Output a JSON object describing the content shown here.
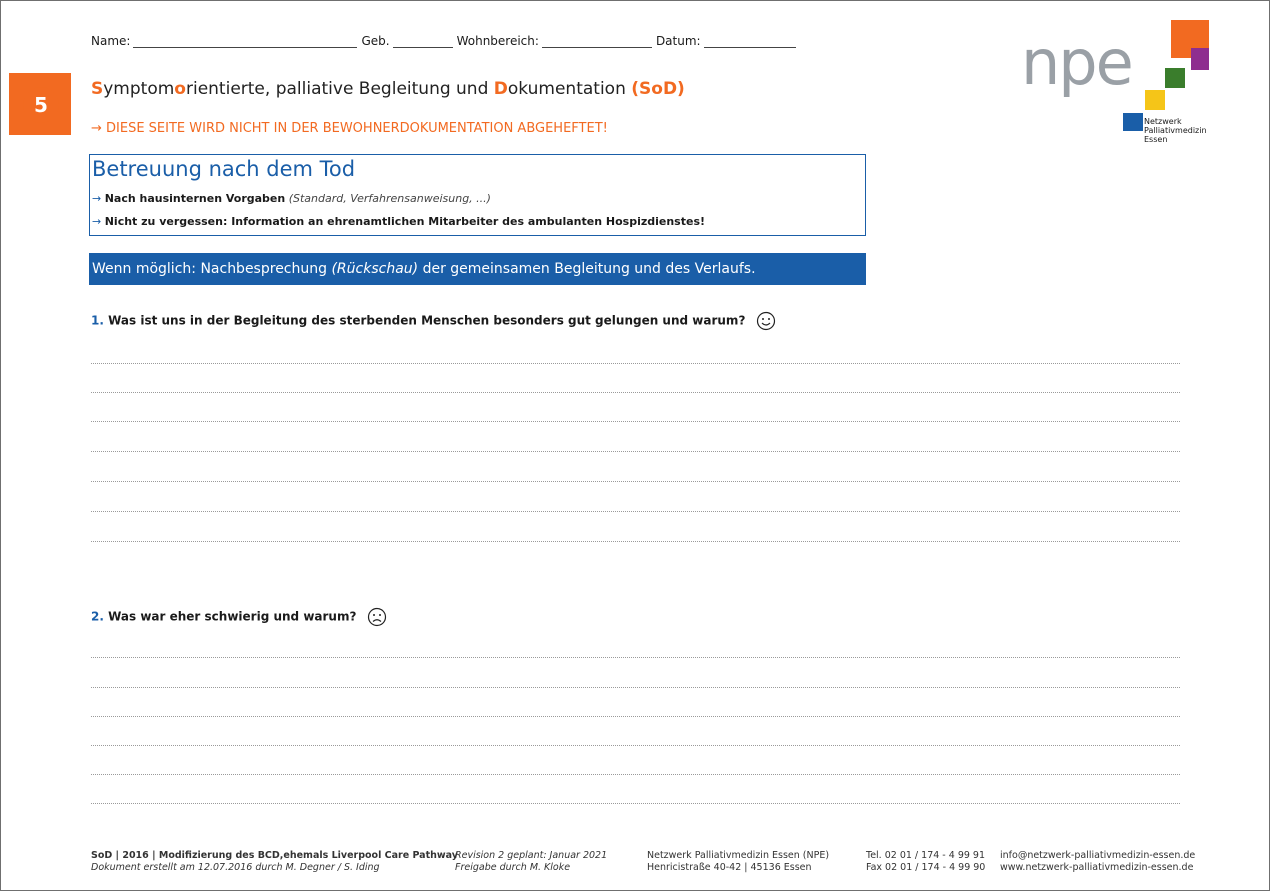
{
  "fields": {
    "name_label": "Name:",
    "geb_label": "Geb.",
    "wohnbereich_label": "Wohnbereich:",
    "datum_label": "Datum:"
  },
  "page_number": "5",
  "title": {
    "s": "S",
    "part1": "ymptom",
    "o": "o",
    "part2": "rientierte, palliative Begleitung und ",
    "d": "D",
    "part3": "okumentation ",
    "abbr": "(SoD)"
  },
  "notice": "→ DIESE SEITE WIRD NICHT IN DER BEWOHNERDOKUMENTATION ABGEHEFTET!",
  "logo": {
    "text": "npe",
    "line1": "Netzwerk",
    "line2": "Palliativmedizin",
    "line3": "Essen",
    "colors": [
      "#f26a21",
      "#8e2e8f",
      "#3a7d2c",
      "#f5c518",
      "#1a5ea8"
    ]
  },
  "box": {
    "title": "Betreuung nach dem Tod",
    "arrow": "→",
    "item1_bold": "Nach hausinternen Vorgaben",
    "item1_italic": "(Standard, Verfahrensanweisung, ...)",
    "item2_bold": "Nicht zu vergessen: Information an ehrenamtlichen Mitarbeiter des ambulanten Hospizdienstes!"
  },
  "bar": {
    "part1": "Wenn möglich: Nachbesprechung ",
    "italic": "(Rückschau)",
    "part2": " der gemeinsamen Begleitung und des Verlaufs."
  },
  "questions": [
    {
      "number": "1.",
      "text": "Was ist uns in der Begleitung des sterbenden Menschen besonders gut gelungen und warum?",
      "icon": "smiley-happy-icon"
    },
    {
      "number": "2.",
      "text": "Was war eher schwierig und warum?",
      "icon": "smiley-sad-icon"
    }
  ],
  "footer": {
    "col1_line1": "SoD | 2016 | Modifizierung des BCD,ehemals Liverpool Care Pathway",
    "col1_line2": "Dokument erstellt am 12.07.2016 durch M. Degner / S. Iding",
    "col2_line1": "Revision 2 geplant: Januar 2021",
    "col2_line2": "Freigabe durch M. Kloke",
    "col3_line1": "Netzwerk Palliativmedizin Essen (NPE)",
    "col3_line2": "Henricistraße 40-42 | 45136 Essen",
    "col4_line1": "Tel. 02 01 / 174 - 4 99 91",
    "col4_line2": "Fax 02 01 / 174 - 4 99 90",
    "col5_line1": "info@netzwerk-palliativmedizin-essen.de",
    "col5_line2": "www.netzwerk-palliativmedizin-essen.de"
  }
}
